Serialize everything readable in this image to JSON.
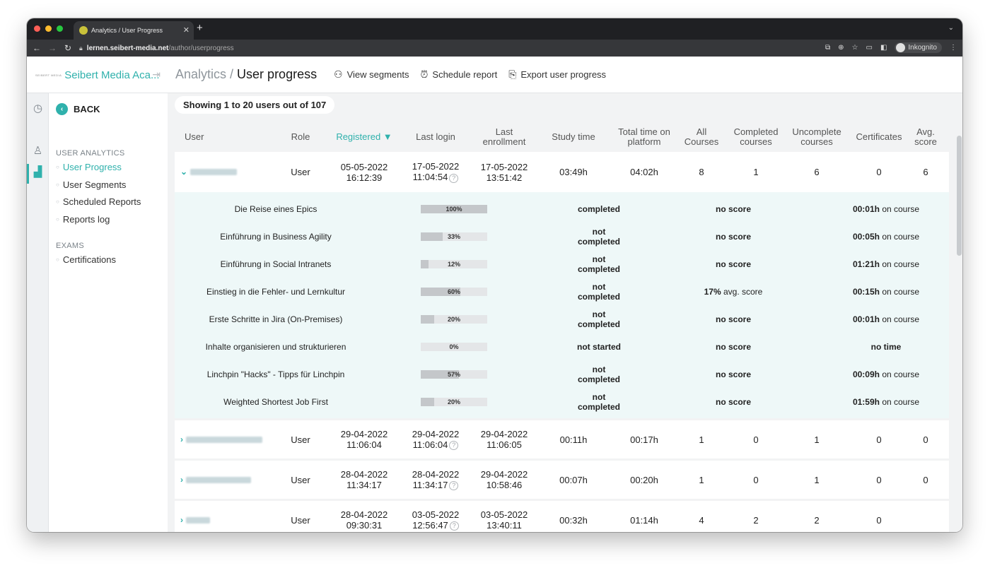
{
  "browser": {
    "tab_title": "Analytics / User Progress",
    "url_host": "lernen.seibert-media.net",
    "url_path": "/author/userprogress",
    "profile_label": "Inkognito"
  },
  "app": {
    "brand_logo": "SEIBERT MEDIA",
    "brand_name": "Seibert Media Aca...",
    "title_crumb": "Analytics /",
    "title_current": "User progress",
    "actions": [
      "View segments",
      "Schedule report",
      "Export user progress"
    ]
  },
  "sidebar": {
    "back_label": "BACK",
    "section_analytics": "USER ANALYTICS",
    "analytics_items": [
      "User Progress",
      "User Segments",
      "Scheduled Reports",
      "Reports log"
    ],
    "section_exams": "EXAMS",
    "exam_items": [
      "Certifications"
    ]
  },
  "table": {
    "showing": "Showing 1 to 20 users out of 107",
    "headers": [
      "User",
      "Role",
      "Registered ▼",
      "Last login",
      "Last enrollment",
      "Study time",
      "Total time on platform",
      "All Courses",
      "Completed courses",
      "Uncomplete courses",
      "Certificates",
      "Avg. score"
    ],
    "rows": [
      {
        "role": "User",
        "reg_date": "05-05-2022",
        "reg_time": "16:12:39",
        "login_date": "17-05-2022",
        "login_time": "11:04:54",
        "enr_date": "17-05-2022",
        "enr_time": "13:51:42",
        "study": "03:49h",
        "total": "04:02h",
        "all": "8",
        "completed": "1",
        "uncomplete": "6",
        "certs": "0",
        "avg": "6"
      },
      {
        "role": "User",
        "reg_date": "29-04-2022",
        "reg_time": "11:06:04",
        "login_date": "29-04-2022",
        "login_time": "11:06:04",
        "enr_date": "29-04-2022",
        "enr_time": "11:06:05",
        "study": "00:11h",
        "total": "00:17h",
        "all": "1",
        "completed": "0",
        "uncomplete": "1",
        "certs": "0",
        "avg": "0"
      },
      {
        "role": "User",
        "reg_date": "28-04-2022",
        "reg_time": "11:34:17",
        "login_date": "28-04-2022",
        "login_time": "11:34:17",
        "enr_date": "29-04-2022",
        "enr_time": "10:58:46",
        "study": "00:07h",
        "total": "00:20h",
        "all": "1",
        "completed": "0",
        "uncomplete": "1",
        "certs": "0",
        "avg": "0"
      },
      {
        "role": "User",
        "reg_date": "28-04-2022",
        "reg_time": "09:30:31",
        "login_date": "03-05-2022",
        "login_time": "12:56:47",
        "enr_date": "03-05-2022",
        "enr_time": "13:40:11",
        "study": "00:32h",
        "total": "01:14h",
        "all": "4",
        "completed": "2",
        "uncomplete": "2",
        "certs": "0",
        "avg": ""
      }
    ],
    "courses": [
      {
        "name": "Die Reise eines Epics",
        "progress": 100,
        "progress_label": "100%",
        "status": "completed",
        "score_bold": "no score",
        "score_rest": "",
        "time_bold": "00:01h",
        "time_rest": " on course"
      },
      {
        "name": "Einführung in Business Agility",
        "progress": 33,
        "progress_label": "33%",
        "status": "not completed",
        "score_bold": "no score",
        "score_rest": "",
        "time_bold": "00:05h",
        "time_rest": " on course"
      },
      {
        "name": "Einführung in Social Intranets",
        "progress": 12,
        "progress_label": "12%",
        "status": "not completed",
        "score_bold": "no score",
        "score_rest": "",
        "time_bold": "01:21h",
        "time_rest": " on course"
      },
      {
        "name": "Einstieg in die Fehler- und Lernkultur",
        "progress": 60,
        "progress_label": "60%",
        "status": "not completed",
        "score_bold": "17%",
        "score_rest": " avg. score",
        "time_bold": "00:15h",
        "time_rest": " on course"
      },
      {
        "name": "Erste Schritte in Jira (On-Premises)",
        "progress": 20,
        "progress_label": "20%",
        "status": "not completed",
        "score_bold": "no score",
        "score_rest": "",
        "time_bold": "00:01h",
        "time_rest": " on course"
      },
      {
        "name": "Inhalte organisieren und strukturieren",
        "progress": 0,
        "progress_label": "0%",
        "status": "not started",
        "score_bold": "no score",
        "score_rest": "",
        "time_bold": "no time",
        "time_rest": ""
      },
      {
        "name": "Linchpin \"Hacks\" - Tipps für Linchpin",
        "progress": 57,
        "progress_label": "57%",
        "status": "not completed",
        "score_bold": "no score",
        "score_rest": "",
        "time_bold": "00:09h",
        "time_rest": " on course"
      },
      {
        "name": "Weighted Shortest Job First",
        "progress": 20,
        "progress_label": "20%",
        "status": "not completed",
        "score_bold": "no score",
        "score_rest": "",
        "time_bold": "01:59h",
        "time_rest": " on course"
      }
    ]
  },
  "colors": {
    "accent": "#2fb1ac",
    "expanded_bg": "#eef8f8"
  }
}
